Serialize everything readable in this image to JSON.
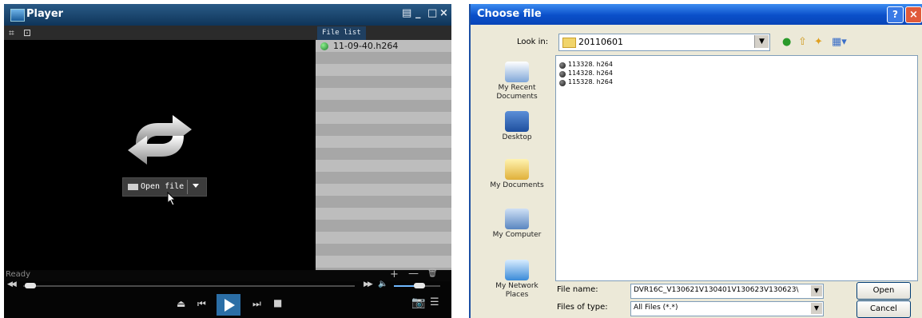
{
  "player": {
    "title": "Player",
    "window_buttons": {
      "menu": "▤",
      "minimize": "_",
      "maximize": "□",
      "close": "×"
    },
    "open_file_label": "Open file",
    "file_list": {
      "tab_label": "File list",
      "items": [
        {
          "name": "11-09-40.h264"
        }
      ]
    },
    "status_text": "Ready",
    "volume_level_percent": 45,
    "icons": [
      "repeat-icon",
      "folder-icon",
      "eject-icon",
      "previous-icon",
      "play-icon",
      "next-icon",
      "stop-icon",
      "camera-icon",
      "list-icon",
      "speaker-icon"
    ]
  },
  "dialog": {
    "title": "Choose file",
    "help_label": "?",
    "close_label": "×",
    "look_in_label": "Look in:",
    "look_in_value": "20110601",
    "places": [
      {
        "label": "My Recent Documents",
        "icon": "recent-documents-icon"
      },
      {
        "label": "Desktop",
        "icon": "desktop-icon"
      },
      {
        "label": "My Documents",
        "icon": "my-documents-icon"
      },
      {
        "label": "My Computer",
        "icon": "my-computer-icon"
      },
      {
        "label": "My Network Places",
        "icon": "network-places-icon"
      }
    ],
    "files": [
      "113328. h264",
      "114328. h264",
      "115328. h264"
    ],
    "file_name_label": "File name:",
    "file_name_value": "DVR16C_V130621V130401V130623V130623\\",
    "files_of_type_label": "Files of type:",
    "files_of_type_value": "All Files (*.*)",
    "open_button": "Open",
    "cancel_button": "Cancel"
  }
}
